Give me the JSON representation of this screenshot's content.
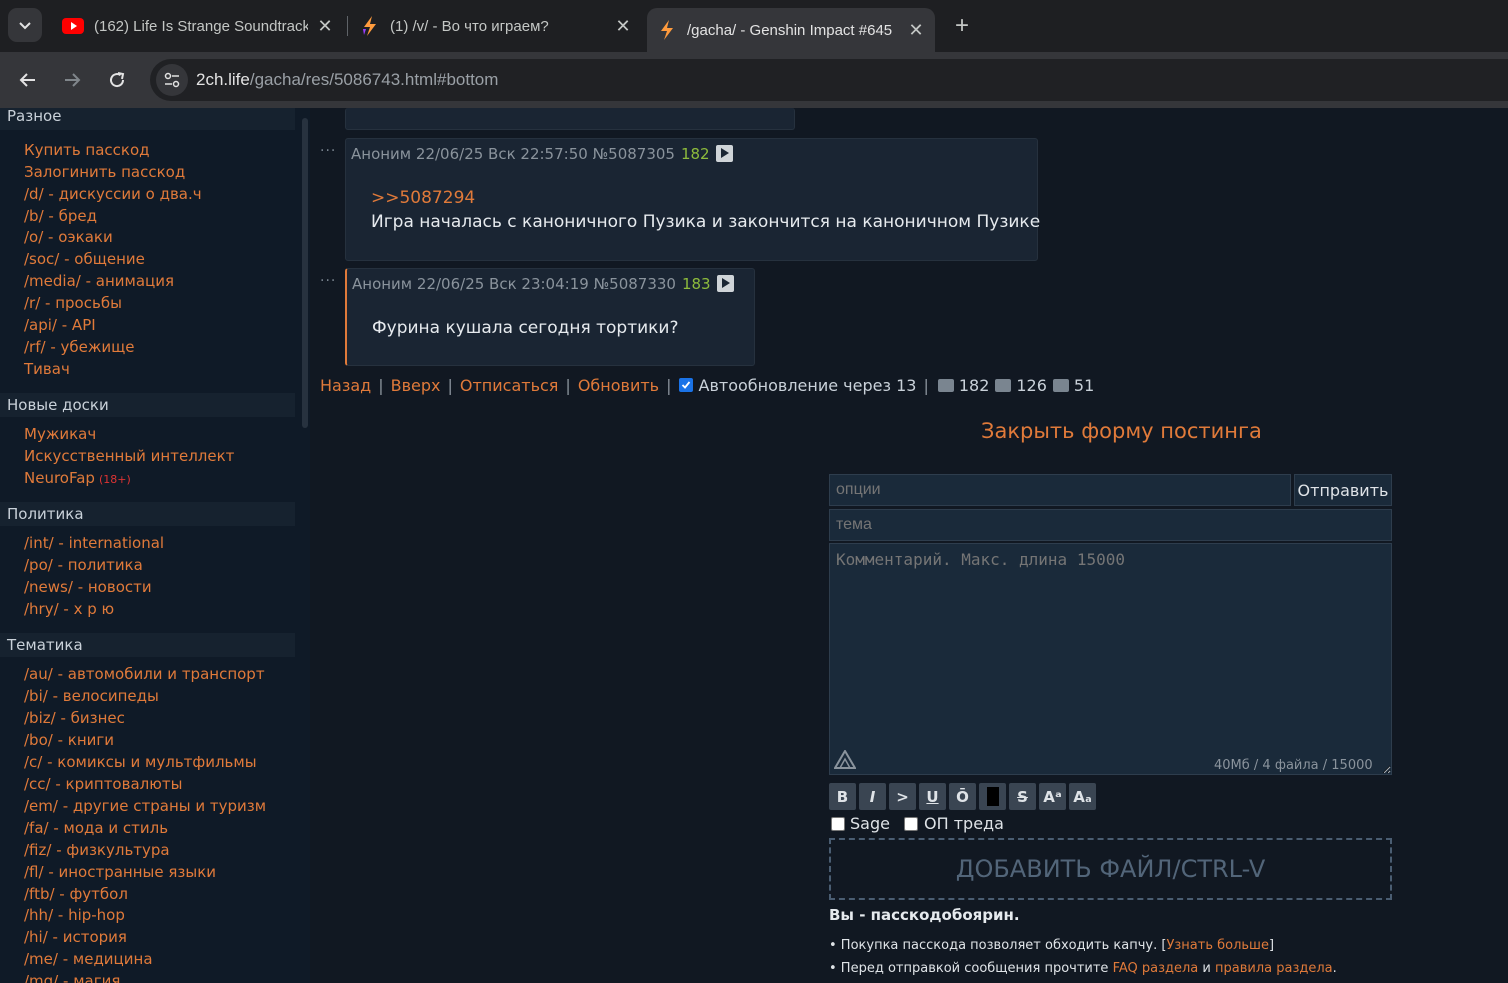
{
  "browser": {
    "tabs": [
      {
        "title": "(162) Life Is Strange Soundtrack",
        "icon": "youtube-icon"
      },
      {
        "title": "(1) /v/ - Во что играем?",
        "icon": "dvach-icon"
      },
      {
        "title": "/gacha/ - Genshin Impact #645",
        "icon": "dvach-icon"
      }
    ],
    "url_host": "2ch.life",
    "url_path": "/gacha/res/5086743.html#bottom"
  },
  "sidebar": {
    "sections": [
      {
        "title": "Разное",
        "items": [
          "Купить пасскод",
          "Залогинить пасскод",
          "/d/ - дискуссии о два.ч",
          "/b/ - бред",
          "/o/ - оэкаки",
          "/soc/ - общение",
          "/media/ - анимация",
          "/r/ - просьбы",
          "/api/ - API",
          "/rf/ - убежище",
          "Тивач"
        ]
      },
      {
        "title": "Новые доски",
        "items": [
          "Мужикач",
          "Искусственный интеллект",
          "NeuroFap"
        ],
        "badge": "(18+)"
      },
      {
        "title": "Политика",
        "items": [
          "/int/ - international",
          "/po/ - политика",
          "/news/ - новости",
          "/hry/ - х р ю"
        ]
      },
      {
        "title": "Тематика",
        "items": [
          "/au/ - автомобили и транспорт",
          "/bi/ - велосипеды",
          "/biz/ - бизнес",
          "/bo/ - книги",
          "/c/ - комиксы и мультфильмы",
          "/cc/ - криптовалюты",
          "/em/ - другие страны и туризм",
          "/fa/ - мода и стиль",
          "/fiz/ - физкультура",
          "/fl/ - иностранные языки",
          "/ftb/ - футбол",
          "/hh/ - hip-hop",
          "/hi/ - история",
          "/me/ - медицина",
          "/mg/ - магия"
        ]
      }
    ]
  },
  "posts": [
    {
      "author": "Аноним",
      "datetime": "22/06/25 Вск 22:57:50",
      "id": "№5087305",
      "num": "182",
      "reply": ">>5087294",
      "text": "Игра началась с каноничного Пузика и закончится на каноничном Пузике"
    },
    {
      "author": "Аноним",
      "datetime": "22/06/25 Вск 23:04:19",
      "id": "№5087330",
      "num": "183",
      "reply": "",
      "text": "Фурина кушала сегодня тортики?"
    }
  ],
  "thread_nav": {
    "back": "Назад",
    "top": "Вверх",
    "unsubscribe": "Отписаться",
    "refresh": "Обновить",
    "auto_update": "Автообновление через 13",
    "posts_count": "182",
    "images_count": "126",
    "posters_count": "51"
  },
  "form": {
    "close_label": "Закрыть форму постинга",
    "options_placeholder": "опции",
    "send_label": "Отправить",
    "subject_placeholder": "тема",
    "comment_placeholder": "Комментарий. Макс. длина 15000",
    "limits": "40Мб / 4 файла / 15000",
    "format_buttons": [
      "B",
      "I",
      ">",
      "U",
      "Ō",
      "",
      "S",
      "Aᵃ",
      "Aₐ"
    ],
    "sage_label": "Sage",
    "op_label": "ОП треда",
    "dropzone": "ДОБАВИТЬ ФАЙЛ/CTRL-V",
    "passcode_status": "Вы - пасскодобоярин.",
    "note1_text": "• Покупка пасскода позволяет обходить капчу. [",
    "note1_link": "Узнать больше",
    "note1_end": "]",
    "note2_text": "• Перед отправкой сообщения прочтите ",
    "note2_link1": "FAQ раздела",
    "note2_and": " и ",
    "note2_link2": "правила раздела",
    "note2_end": "."
  }
}
